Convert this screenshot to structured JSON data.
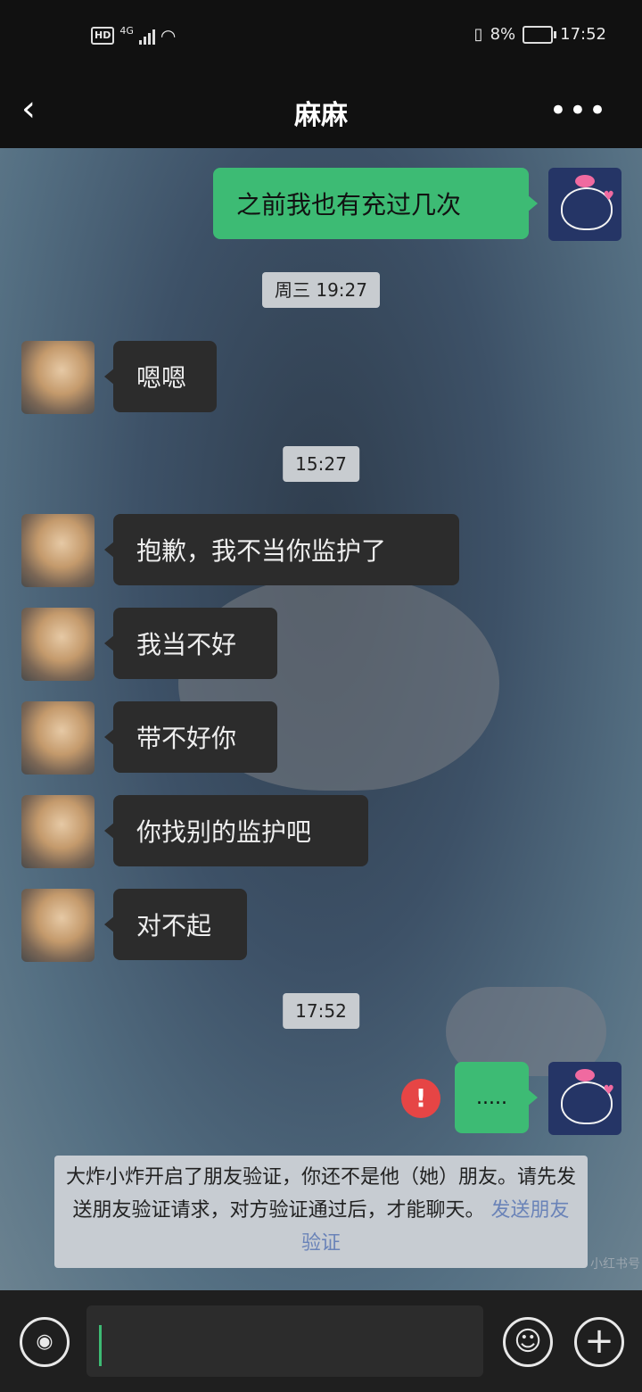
{
  "status_bar": {
    "hd": "HD",
    "network": "4G",
    "battery_percent": "8%",
    "time": "17:52",
    "icons": [
      "signal-icon",
      "wifi-icon",
      "vibrate-icon",
      "battery-charging-icon"
    ]
  },
  "header": {
    "back_icon": "‹",
    "title": "麻麻",
    "more_icon": "•••"
  },
  "messages": {
    "m1": "之前我也有充过几次",
    "t1": "周三 19:27",
    "m2": "嗯嗯",
    "t2": "15:27",
    "m3": "抱歉，我不当你监护了",
    "m4": "我当不好",
    "m5": "带不好你",
    "m6": "你找别的监护吧",
    "m7": "对不起",
    "t3": "17:52",
    "m8": ".....",
    "error_mark": "!"
  },
  "system_notice": {
    "text": "大炸小炸开启了朋友验证，你还不是他（她）朋友。请先发送朋友验证请求，对方验证通过后，才能聊天。",
    "link": "发送朋友验证"
  },
  "watermark": "小红书号",
  "input_bar": {
    "voice_icon": "◉",
    "emoji_icon": "☺",
    "plus_icon": "+"
  },
  "colors": {
    "out_bubble": "#3dbb74",
    "in_bubble": "#2c2c2c",
    "error": "#e64545"
  }
}
